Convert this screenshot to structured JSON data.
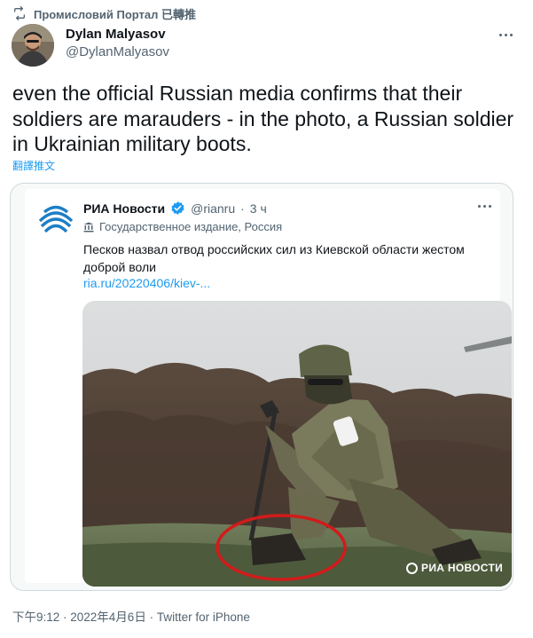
{
  "retweet": {
    "icon": "retweet-icon",
    "text": "Промисловий Портал 已轉推"
  },
  "author": {
    "display_name": "Dylan Malyasov",
    "handle": "@DylanMalyasov",
    "avatar_icon": "avatar"
  },
  "tweet": {
    "text": "even the official Russian media confirms that their soldiers are marauders - in the photo, a Russian soldier in Ukrainian military boots.",
    "translate_label": "翻譯推文"
  },
  "quote": {
    "name": "РИА Новости",
    "handle": "@rianru",
    "time": "3 ч",
    "separator": "·",
    "label": "Государственное издание, Россия",
    "text": "Песков назвал отвод российских сил из Киевской области жестом доброй воли",
    "link": "ria.ru/20220406/kiev-...",
    "watermark": "РИА НОВОСТИ"
  },
  "footer": {
    "text": "下午9:12 · 2022年4月6日 · Twitter for iPhone"
  },
  "colors": {
    "accent": "#1d9bf0",
    "secondary_text": "#536471",
    "highlight_circle": "#d11b1b"
  }
}
